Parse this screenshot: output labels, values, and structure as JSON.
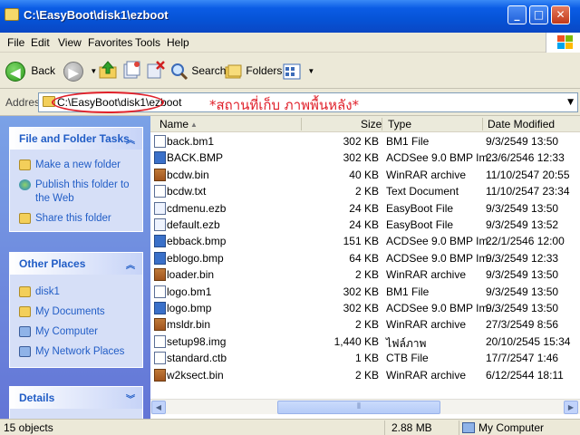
{
  "window": {
    "title": "C:\\EasyBoot\\disk1\\ezboot"
  },
  "menu": [
    "File",
    "Edit",
    "View",
    "Favorites",
    "Tools",
    "Help"
  ],
  "toolbar": {
    "back": "Back",
    "search": "Search",
    "folders": "Folders"
  },
  "address": {
    "label": "Address",
    "path": "C:\\EasyBoot\\disk1\\ezboot",
    "annotation": "*สถานที่เก็บ ภาพพื้นหลัง*",
    "annotation_color": "#e0202a"
  },
  "tasks": {
    "file_folder": {
      "title": "File and Folder Tasks",
      "items": [
        "Make a new folder",
        "Publish this folder to the Web",
        "Share this folder"
      ]
    },
    "other_places": {
      "title": "Other Places",
      "items": [
        "disk1",
        "My Documents",
        "My Computer",
        "My Network Places"
      ]
    },
    "details": {
      "title": "Details"
    }
  },
  "columns": {
    "name": "Name",
    "size": "Size",
    "type": "Type",
    "date": "Date Modified"
  },
  "files": [
    {
      "name": "back.bm1",
      "size": "302 KB",
      "type": "BM1 File",
      "date": "9/3/2549 13:50",
      "icon": "generic"
    },
    {
      "name": "BACK.BMP",
      "size": "302 KB",
      "type": "ACDSee 9.0 BMP Im...",
      "date": "23/6/2546 12:33",
      "icon": "bmp"
    },
    {
      "name": "bcdw.bin",
      "size": "40 KB",
      "type": "WinRAR archive",
      "date": "11/10/2547 20:55",
      "icon": "rar"
    },
    {
      "name": "bcdw.txt",
      "size": "2 KB",
      "type": "Text Document",
      "date": "11/10/2547 23:34",
      "icon": "txt"
    },
    {
      "name": "cdmenu.ezb",
      "size": "24 KB",
      "type": "EasyBoot File",
      "date": "9/3/2549 13:50",
      "icon": "ezb"
    },
    {
      "name": "default.ezb",
      "size": "24 KB",
      "type": "EasyBoot File",
      "date": "9/3/2549 13:52",
      "icon": "ezb"
    },
    {
      "name": "ebback.bmp",
      "size": "151 KB",
      "type": "ACDSee 9.0 BMP Im...",
      "date": "22/1/2546 12:00",
      "icon": "bmp"
    },
    {
      "name": "eblogo.bmp",
      "size": "64 KB",
      "type": "ACDSee 9.0 BMP Im...",
      "date": "9/3/2549 12:33",
      "icon": "bmp"
    },
    {
      "name": "loader.bin",
      "size": "2 KB",
      "type": "WinRAR archive",
      "date": "9/3/2549 13:50",
      "icon": "rar"
    },
    {
      "name": "logo.bm1",
      "size": "302 KB",
      "type": "BM1 File",
      "date": "9/3/2549 13:50",
      "icon": "generic"
    },
    {
      "name": "logo.bmp",
      "size": "302 KB",
      "type": "ACDSee 9.0 BMP Im...",
      "date": "9/3/2549 13:50",
      "icon": "bmp"
    },
    {
      "name": "msldr.bin",
      "size": "2 KB",
      "type": "WinRAR archive",
      "date": "27/3/2549 8:56",
      "icon": "rar"
    },
    {
      "name": "setup98.img",
      "size": "1,440 KB",
      "type": "ไฟล์ภาพ",
      "date": "20/10/2545 15:34",
      "icon": "generic"
    },
    {
      "name": "standard.ctb",
      "size": "1 KB",
      "type": "CTB File",
      "date": "17/7/2547 1:46",
      "icon": "generic"
    },
    {
      "name": "w2ksect.bin",
      "size": "2 KB",
      "type": "WinRAR archive",
      "date": "6/12/2544 18:11",
      "icon": "rar"
    }
  ],
  "status": {
    "objects": "15 objects",
    "size": "2.88 MB",
    "location": "My Computer"
  }
}
